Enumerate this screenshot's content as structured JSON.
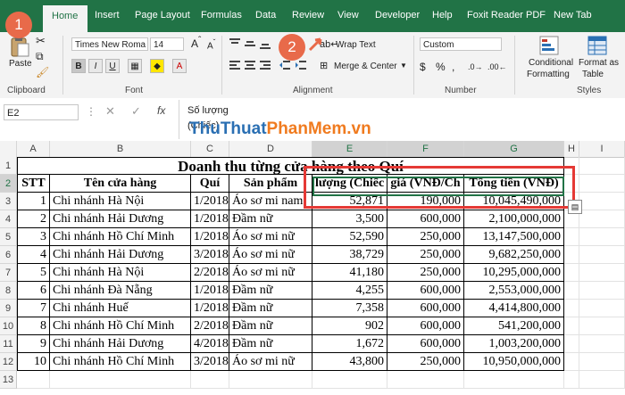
{
  "ribbon_tabs": [
    "Home",
    "Insert",
    "Page Layout",
    "Formulas",
    "Data",
    "Review",
    "View",
    "Developer",
    "Help",
    "Foxit Reader PDF",
    "New Tab"
  ],
  "clipboard": {
    "paste": "Paste",
    "label": "Clipboard"
  },
  "font": {
    "name": "Times New Roma",
    "size": "14",
    "bold": "B",
    "italic": "I",
    "underline": "U",
    "label": "Font"
  },
  "alignment": {
    "wrap_text": "Wrap Text",
    "merge_center": "Merge & Center",
    "label": "Alignment"
  },
  "number": {
    "format": "Custom",
    "label": "Number",
    "currency": "$",
    "percent": "%",
    "comma": ","
  },
  "styles": {
    "conditional": "Conditional",
    "formatting": "Formatting",
    "format_as": "Format as",
    "table": "Table",
    "label": "Styles"
  },
  "formula_bar": {
    "name_box": "E2",
    "fx": "fx",
    "content_line1": "Số lượng",
    "content_line2": "(Chiếc)"
  },
  "watermark": "ThuThuatPhanMem.vn",
  "columns": [
    "A",
    "B",
    "C",
    "D",
    "E",
    "F",
    "G",
    "H",
    "I"
  ],
  "rows": [
    "1",
    "2",
    "3",
    "4",
    "5",
    "6",
    "7",
    "8",
    "9",
    "10",
    "11",
    "12",
    "13"
  ],
  "sheet": {
    "title": "Doanh thu từng cửa hàng theo Quí",
    "headers": {
      "stt": "STT",
      "store": "Tên cửa hàng",
      "quarter": "Quí",
      "product": "Sản phẩm",
      "qty": "lượng (Chiếc",
      "price": "giá (VNĐ/Ch",
      "total": "Tổng tiền (VNĐ)"
    },
    "data": [
      {
        "stt": "1",
        "store": "Chi nhánh Hà Nội",
        "quarter": "1/2018",
        "product": "Áo sơ mi nam",
        "qty": "52,871",
        "price": "190,000",
        "total": "10,045,490,000"
      },
      {
        "stt": "2",
        "store": "Chi nhánh Hải Dương",
        "quarter": "1/2018",
        "product": "Đầm nữ",
        "qty": "3,500",
        "price": "600,000",
        "total": "2,100,000,000"
      },
      {
        "stt": "3",
        "store": "Chi nhánh Hồ Chí Minh",
        "quarter": "1/2018",
        "product": "Áo sơ mi nữ",
        "qty": "52,590",
        "price": "250,000",
        "total": "13,147,500,000"
      },
      {
        "stt": "4",
        "store": "Chi nhánh Hải Dương",
        "quarter": "3/2018",
        "product": "Áo sơ mi nữ",
        "qty": "38,729",
        "price": "250,000",
        "total": "9,682,250,000"
      },
      {
        "stt": "5",
        "store": "Chi nhánh Hà Nội",
        "quarter": "2/2018",
        "product": "Áo sơ mi nữ",
        "qty": "41,180",
        "price": "250,000",
        "total": "10,295,000,000"
      },
      {
        "stt": "6",
        "store": "Chi nhánh Đà Nẵng",
        "quarter": "1/2018",
        "product": "Đầm nữ",
        "qty": "4,255",
        "price": "600,000",
        "total": "2,553,000,000"
      },
      {
        "stt": "7",
        "store": "Chi nhánh Huế",
        "quarter": "1/2018",
        "product": "Đầm nữ",
        "qty": "7,358",
        "price": "600,000",
        "total": "4,414,800,000"
      },
      {
        "stt": "8",
        "store": "Chi nhánh Hồ Chí Minh",
        "quarter": "2/2018",
        "product": "Đầm nữ",
        "qty": "902",
        "price": "600,000",
        "total": "541,200,000"
      },
      {
        "stt": "9",
        "store": "Chi nhánh Hải Dương",
        "quarter": "4/2018",
        "product": "Đầm nữ",
        "qty": "1,672",
        "price": "600,000",
        "total": "1,003,200,000"
      },
      {
        "stt": "10",
        "store": "Chi nhánh Hồ Chí Minh",
        "quarter": "3/2018",
        "product": "Áo sơ mi nữ",
        "qty": "43,800",
        "price": "250,000",
        "total": "10,950,000,000"
      }
    ]
  },
  "step_badges": [
    "1",
    "2"
  ],
  "colors": {
    "excel_green": "#217346",
    "badge": "#e86a4a",
    "highlight_border": "#e53935",
    "watermark_blue": "#2a6fb3",
    "watermark_orange": "#f07b1f"
  }
}
